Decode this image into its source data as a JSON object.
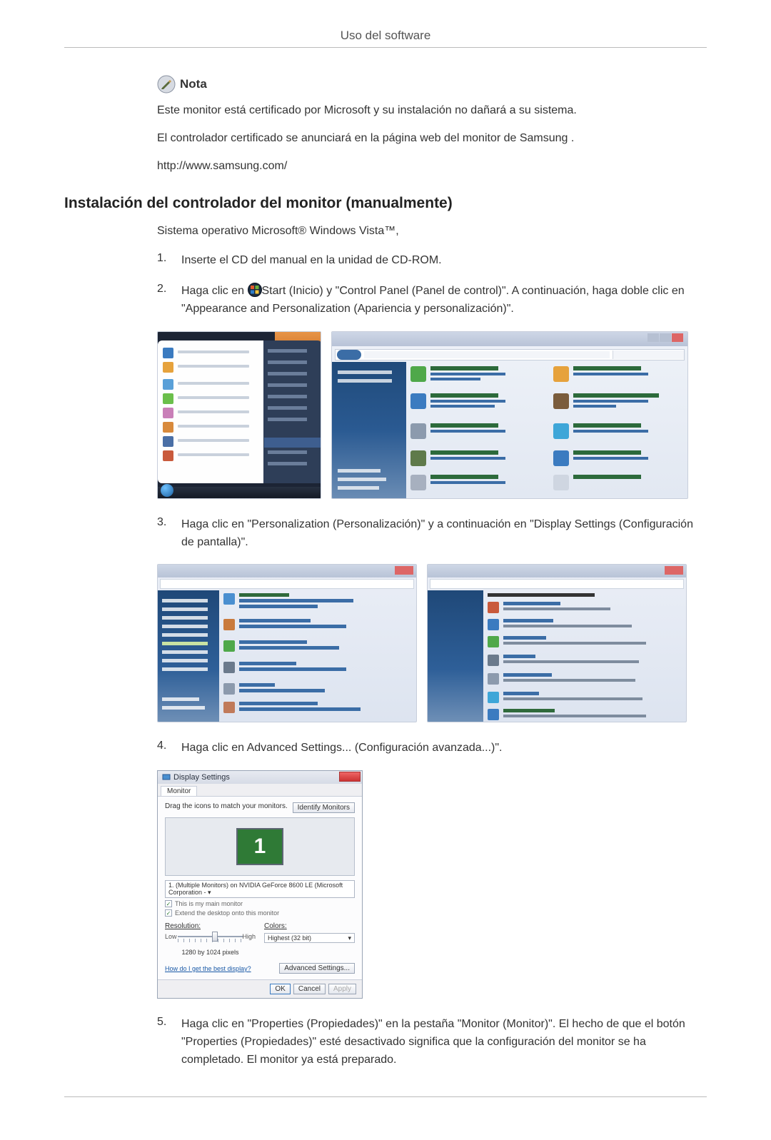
{
  "page": {
    "header_title": "Uso del software"
  },
  "note": {
    "icon_name": "pencil-paper-icon",
    "label": "Nota",
    "lines": [
      "Este monitor está certificado por Microsoft y su instalación no dañará a su sistema.",
      "El controlador certificado se anunciará en la página web del monitor de Samsung .",
      "http://www.samsung.com/"
    ]
  },
  "section": {
    "heading": "Instalación del controlador del monitor (manualmente)",
    "intro": "Sistema operativo Microsoft® Windows Vista™,"
  },
  "steps": {
    "1": {
      "num": "1.",
      "text": "Inserte el CD del manual en la unidad de CD-ROM."
    },
    "2": {
      "num": "2.",
      "prefix": "Haga clic en ",
      "icon_name": "windows-start-icon",
      "suffix": "Start (Inicio) y \"Control Panel (Panel de control)\". A continuación, haga doble clic en \"Appearance and Personalization (Apariencia y personalización)\"."
    },
    "3": {
      "num": "3.",
      "text": "Haga clic en \"Personalization (Personalización)\" y a continuación en \"Display Settings (Configuración de pantalla)\"."
    },
    "4": {
      "num": "4.",
      "text": "Haga clic en Advanced Settings... (Configuración avanzada...)\"."
    },
    "5": {
      "num": "5.",
      "text": "Haga clic en \"Properties (Propiedades)\" en la pestaña \"Monitor (Monitor)\". El hecho de que el botón \"Properties (Propiedades)\" esté desactivado significa que la configuración del monitor se ha completado. El monitor ya está preparado."
    }
  },
  "display_settings": {
    "title": "Display Settings",
    "tab": "Monitor",
    "drag_label": "Drag the icons to match your monitors.",
    "identify_btn": "Identify Monitors",
    "monitor_number": "1",
    "dropdown": "1. (Multiple Monitors) on NVIDIA GeForce 8600 LE (Microsoft Corporation - ▾",
    "chk_main": "This is my main monitor",
    "chk_extend": "Extend the desktop onto this monitor",
    "resolution_label": "Resolution:",
    "low": "Low",
    "high": "High",
    "current_res": "1280 by 1024 pixels",
    "colors_label": "Colors:",
    "colors_value": "Highest (32 bit)",
    "help_link": "How do I get the best display?",
    "advanced_btn": "Advanced Settings...",
    "ok": "OK",
    "cancel": "Cancel",
    "apply": "Apply"
  }
}
